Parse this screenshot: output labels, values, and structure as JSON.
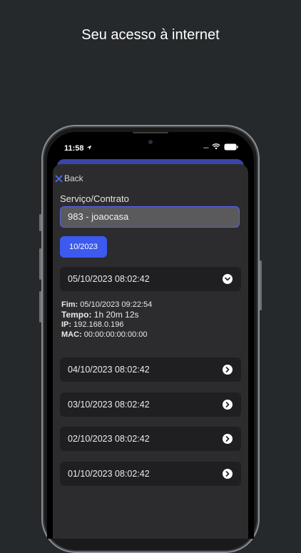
{
  "headline": "Seu acesso à internet",
  "status_bar": {
    "time": "11:58",
    "signal": "....",
    "battery": ""
  },
  "nav": {
    "back_label": "Back"
  },
  "form": {
    "service_label": "Serviço/Contrato",
    "service_value": "983 - joaocasa",
    "month_chip": "10/2023"
  },
  "sessions": [
    {
      "date": "05/10/2023 08:02:42",
      "expanded": true,
      "details": [
        {
          "label": "Fim:",
          "value": "05/10/2023 09:22:54"
        },
        {
          "label": "Tempo:",
          "value": "1h 20m 12s"
        },
        {
          "label": "IP:",
          "value": "192.168.0.196"
        },
        {
          "label": "MAC:",
          "value": "00:00:00:00:00:00"
        }
      ]
    },
    {
      "date": "04/10/2023 08:02:42",
      "expanded": false
    },
    {
      "date": "03/10/2023 08:02:42",
      "expanded": false
    },
    {
      "date": "02/10/2023 08:02:42",
      "expanded": false
    },
    {
      "date": "01/10/2023 08:02:42",
      "expanded": false
    }
  ],
  "colors": {
    "accent": "#3c5af0",
    "background": "#25292c",
    "card": "#1f1f21",
    "sheet": "#2c2c2e"
  }
}
